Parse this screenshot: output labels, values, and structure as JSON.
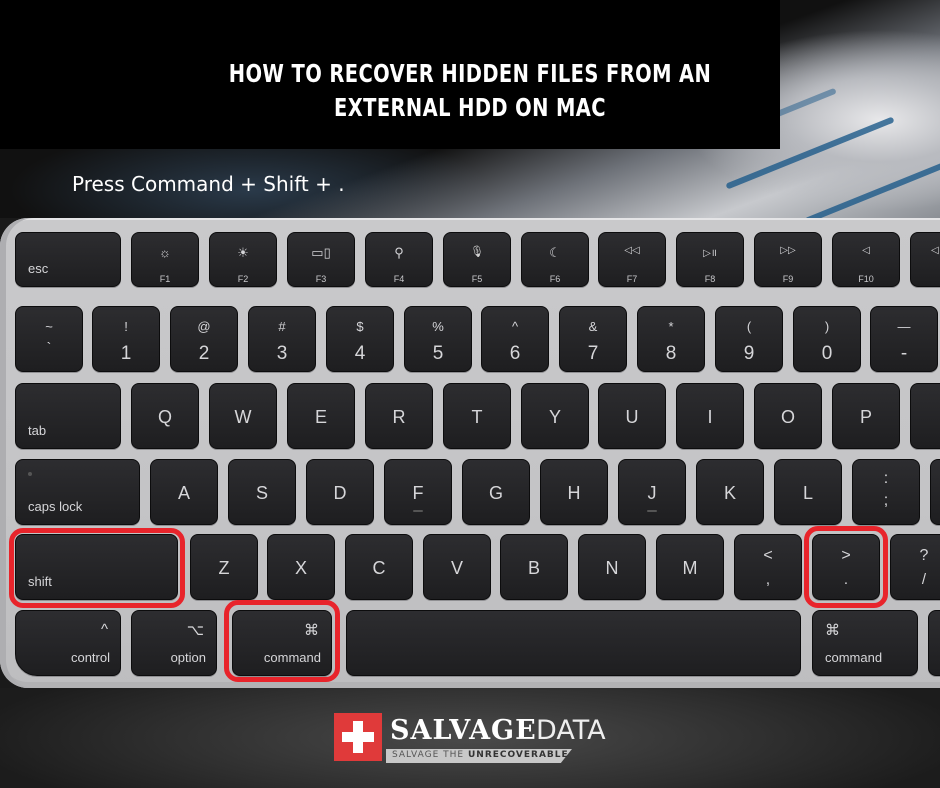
{
  "title": "How to recover hidden files from an external HDD on Mac",
  "title_lines": [
    "How to recover hidden files from an",
    "external HDD on Mac"
  ],
  "instruction": "Press Command + Shift + .",
  "keyboard": {
    "function_row": [
      {
        "label": "esc"
      },
      {
        "icon": "☼",
        "icon_name": "brightness-down",
        "label": "F1"
      },
      {
        "icon": "☀",
        "icon_name": "brightness-up",
        "label": "F2"
      },
      {
        "icon": "▭▯",
        "icon_name": "mission-control",
        "label": "F3"
      },
      {
        "icon": "⚲",
        "icon_name": "spotlight-search",
        "label": "F4"
      },
      {
        "icon": "🎙",
        "icon_name": "dictation-microphone",
        "label": "F5"
      },
      {
        "icon": "☾",
        "icon_name": "do-not-disturb-moon",
        "label": "F6"
      },
      {
        "icon": "◁◁",
        "icon_name": "rewind",
        "label": "F7"
      },
      {
        "icon": "▷॥",
        "icon_name": "play-pause",
        "label": "F8"
      },
      {
        "icon": "▷▷",
        "icon_name": "fast-forward",
        "label": "F9"
      },
      {
        "icon": "◁",
        "icon_name": "mute",
        "label": "F10"
      },
      {
        "icon": "◁",
        "icon_name": "volume-down",
        "label": ""
      }
    ],
    "number_row": [
      {
        "upper": "~",
        "lower": "`"
      },
      {
        "upper": "!",
        "lower": "1"
      },
      {
        "upper": "@",
        "lower": "2"
      },
      {
        "upper": "#",
        "lower": "3"
      },
      {
        "upper": "$",
        "lower": "4"
      },
      {
        "upper": "%",
        "lower": "5"
      },
      {
        "upper": "^",
        "lower": "6"
      },
      {
        "upper": "&",
        "lower": "7"
      },
      {
        "upper": "*",
        "lower": "8"
      },
      {
        "upper": "(",
        "lower": "9"
      },
      {
        "upper": ")",
        "lower": "0"
      },
      {
        "upper": "—",
        "lower": "-"
      }
    ],
    "qwerty_row": {
      "modifier": "tab",
      "keys": [
        "Q",
        "W",
        "E",
        "R",
        "T",
        "Y",
        "U",
        "I",
        "O",
        "P"
      ]
    },
    "home_row": {
      "modifier": "caps lock",
      "keys": [
        "A",
        "S",
        "D",
        "F",
        "G",
        "H",
        "J",
        "K",
        "L"
      ],
      "punct": {
        "upper": ":",
        "lower": ";"
      }
    },
    "shift_row": {
      "modifier": "shift",
      "keys": [
        "Z",
        "X",
        "C",
        "V",
        "B",
        "N",
        "M"
      ],
      "punct": [
        {
          "upper": "<",
          "lower": ","
        },
        {
          "upper": ">",
          "lower": "."
        },
        {
          "upper": "?",
          "lower": "/"
        }
      ]
    },
    "bottom_row": {
      "control": {
        "icon": "^",
        "label": "control"
      },
      "option": {
        "icon": "⌥",
        "label": "option"
      },
      "command_left": {
        "icon": "⌘",
        "label": "command"
      },
      "command_right": {
        "icon": "⌘",
        "label": "command"
      }
    },
    "highlighted_keys": [
      "shift",
      "command",
      "."
    ],
    "highlight_color": "#e8242b"
  },
  "brand": {
    "name_bold": "SALVAGE",
    "name_light": "DATA",
    "tagline_light": "SALVAGE THE ",
    "tagline_bold": "UNRECOVERABLE",
    "accent": "#e03a3a"
  }
}
